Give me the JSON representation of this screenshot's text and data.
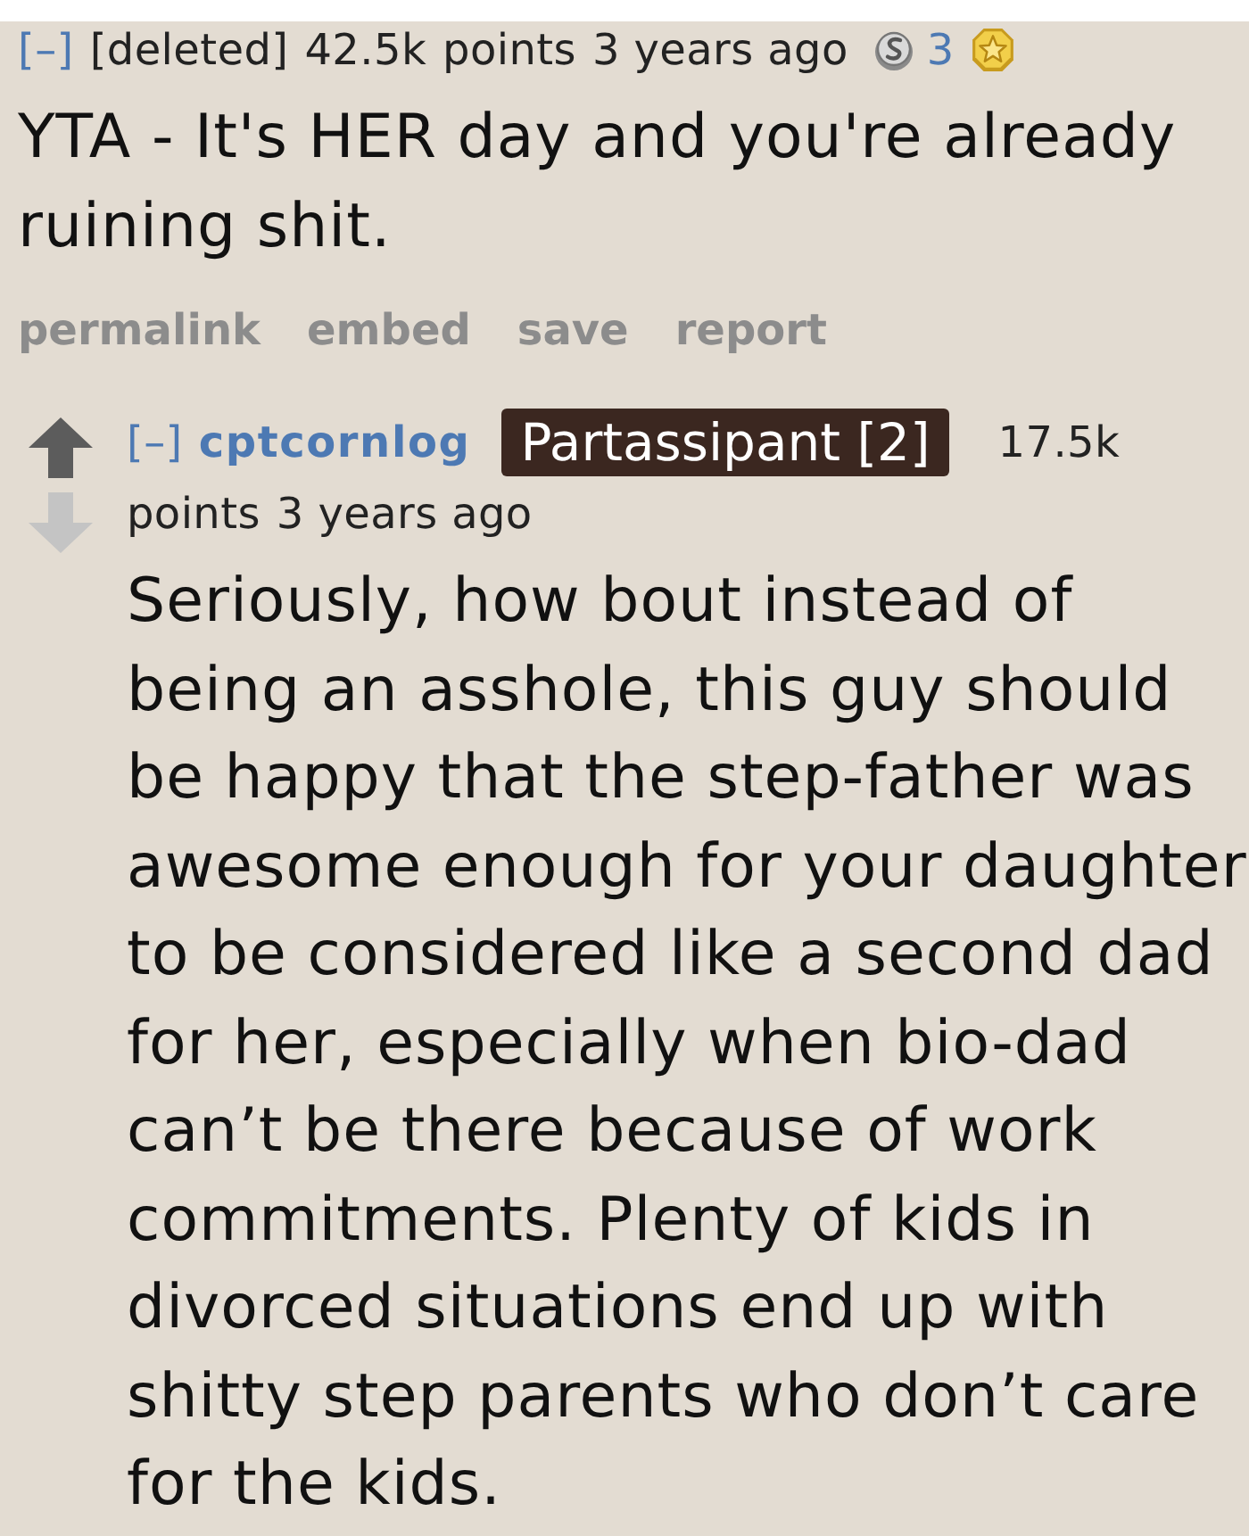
{
  "comments": [
    {
      "kind": "parent",
      "collapse": "[–]",
      "author": "[deleted]",
      "deleted": true,
      "score": "42.5k",
      "score_unit": "points",
      "age": "3 years ago",
      "awards": [
        {
          "kind": "silver",
          "count": "3"
        },
        {
          "kind": "gold"
        }
      ],
      "body": "YTA - It's HER day and you're already ruining shit.",
      "links": [
        "permalink",
        "embed",
        "save",
        "report"
      ]
    },
    {
      "kind": "reply",
      "collapse": "[–]",
      "author": "cptcornlog",
      "deleted": false,
      "flair": "Partassipant [2]",
      "score": "17.5k",
      "score_unit": "points",
      "age": "3 years ago",
      "body": "Seriously, how bout instead of being an asshole, this guy should be happy that the step-father was awesome enough for your daughter to be considered like a second dad for her, especially when bio-dad can’t be there because of work commitments. Plenty of kids in divorced situations end up with shitty step parents who don’t care for the kids."
    }
  ]
}
